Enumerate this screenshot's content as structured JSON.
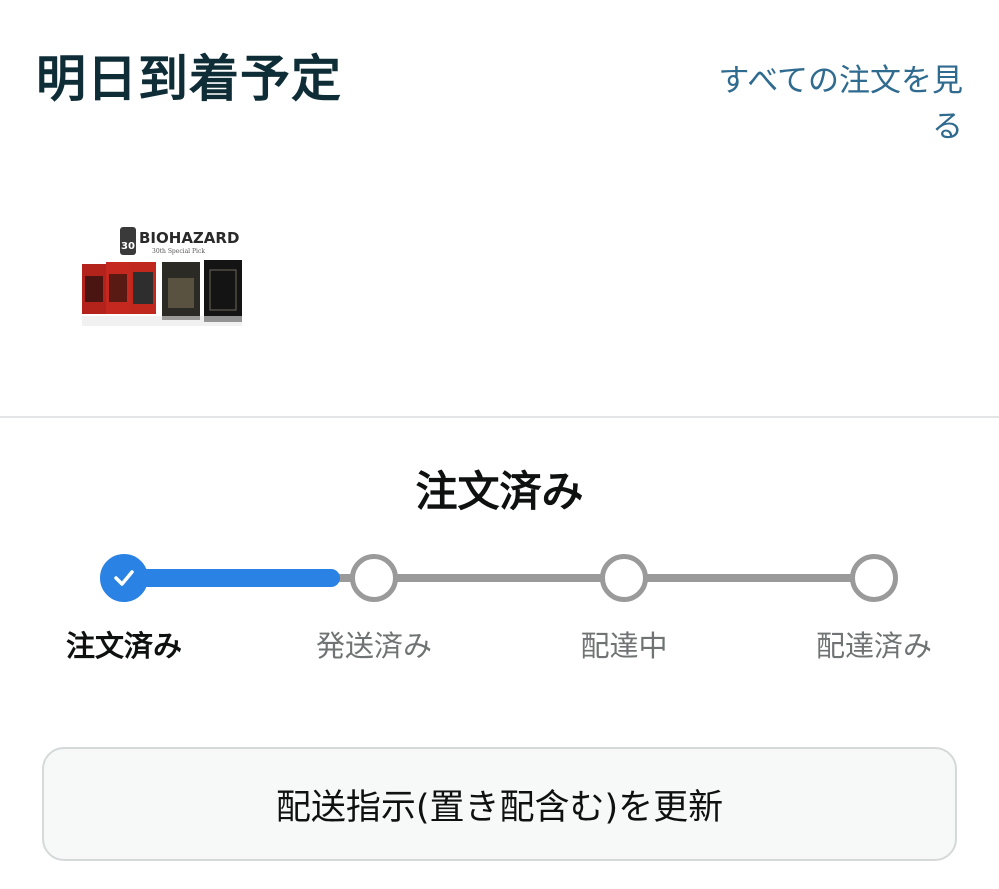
{
  "header": {
    "title": "明日到着予定",
    "all_orders_link": "すべての注文を見る"
  },
  "product": {
    "image_name": "product-image-biohazard-30th",
    "logo_text": "BIOHAZARD",
    "logo_subtext": "30th Special Pick",
    "badge_text": "30"
  },
  "status": {
    "current": "注文済み",
    "steps": [
      {
        "label": "注文済み",
        "done": true
      },
      {
        "label": "発送済み",
        "done": false
      },
      {
        "label": "配達中",
        "done": false
      },
      {
        "label": "配達済み",
        "done": false
      }
    ]
  },
  "actions": {
    "update_delivery_label": "配送指示(置き配含む)を更新"
  },
  "colors": {
    "title": "#0f2d36",
    "link": "#2f6a8f",
    "progress": "#2a82e4",
    "inactive": "#9a9a9a"
  }
}
